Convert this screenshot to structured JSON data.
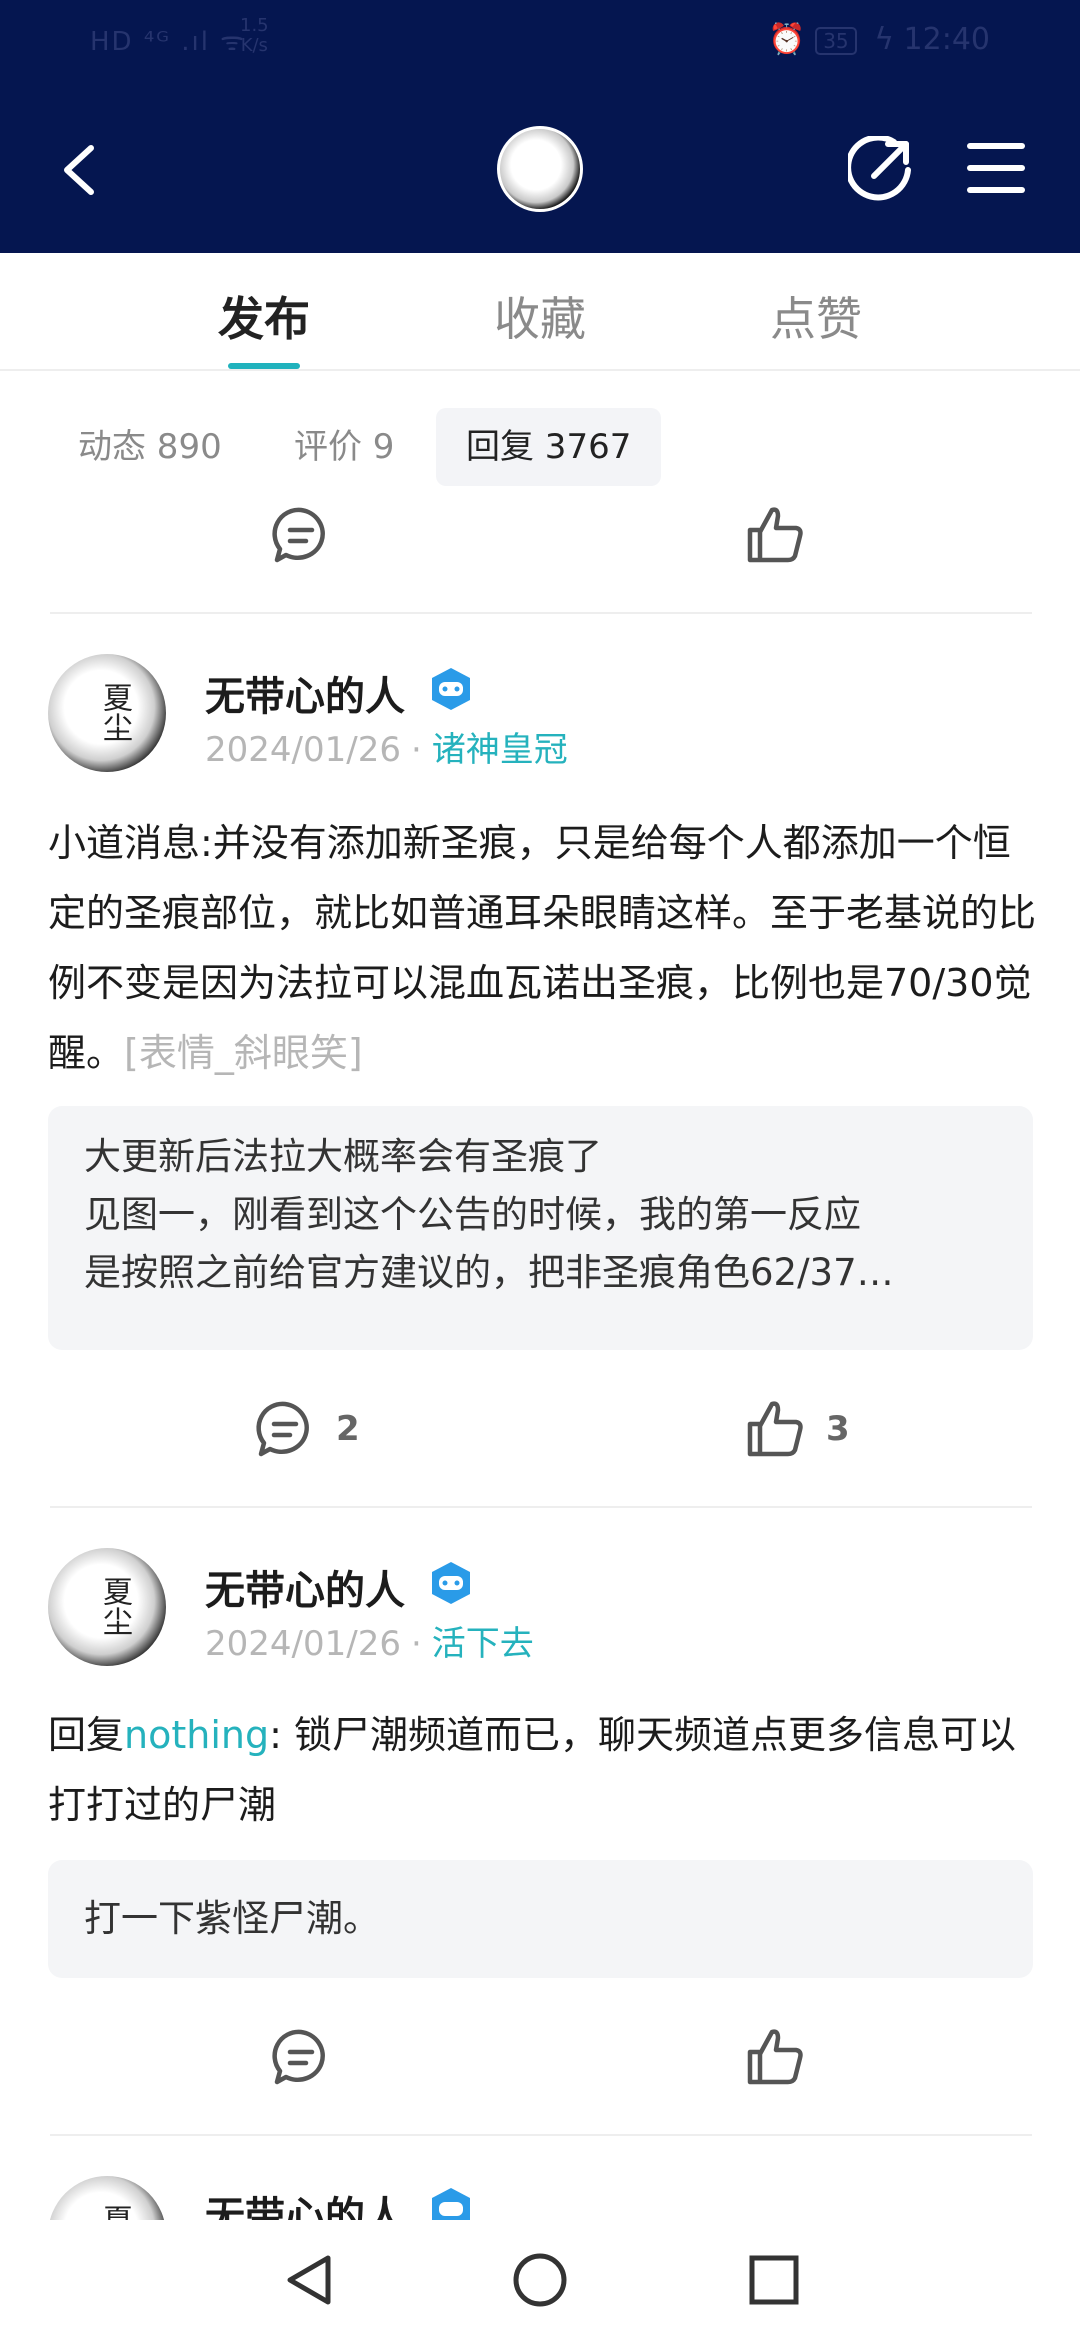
{
  "status_bar": {
    "left": "HD ⁴ᴳ .ıl ᯤ",
    "speed_value": "1.5",
    "speed_unit": "K/s",
    "battery": "35",
    "time": "12:40"
  },
  "header": {
    "back_icon": "back-arrow-icon",
    "share_icon": "share-icon",
    "menu_icon": "menu-icon"
  },
  "tabs": [
    {
      "label": "发布",
      "active": true
    },
    {
      "label": "收藏",
      "active": false
    },
    {
      "label": "点赞",
      "active": false
    }
  ],
  "subtabs": [
    {
      "label": "动态 890"
    },
    {
      "label": "评价 9"
    },
    {
      "label": "回复 3767",
      "active": true
    }
  ],
  "posts": [
    {
      "avatar_text": "夏尘",
      "author": "无带心的人",
      "date": "2024/01/26",
      "tag": "诸神皇冠",
      "body_text": "小道消息:并没有添加新圣痕，只是给每个人都添加一个恒定的圣痕部位，就比如普通耳朵眼睛这样。至于老基说的比例不变是因为法拉可以混血瓦诺出圣痕，比例也是70/30觉醒。",
      "body_emote": "[表情_斜眼笑]",
      "quote_lines": [
        "大更新后法拉大概率会有圣痕了",
        "见图一，刚看到这个公告的时候，我的第一反应",
        "是按照之前给官方建议的，把非圣痕角色62/37…"
      ],
      "comments": "2",
      "likes": "3"
    },
    {
      "avatar_text": "夏尘",
      "author": "无带心的人",
      "date": "2024/01/26",
      "tag": "活下去",
      "body_prefix": "回复",
      "body_mention": "nothing",
      "body_text": ": 锁尸潮频道而已，聊天频道点更多信息可以打打过的尸潮",
      "quote_lines": [
        "打一下紫怪尸潮。"
      ]
    },
    {
      "avatar_text": "夏尘",
      "author": "无带心的人"
    }
  ],
  "dot": "·"
}
